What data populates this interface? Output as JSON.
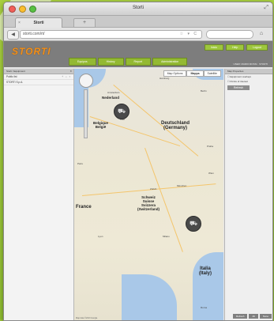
{
  "window": {
    "title": "Storti"
  },
  "tab": {
    "label": "Storti",
    "close": "×",
    "new_tab": "+"
  },
  "address": {
    "url": "storti.com/rt/",
    "icons": "☆ ▾ C"
  },
  "app": {
    "logo": "STORTI",
    "top_buttons": [
      "Inicio",
      "Help",
      "Logout"
    ],
    "nav_tabs": [
      "Equipos",
      "History",
      "Report",
      "Administration"
    ],
    "user_line": "USER: MARIO ROSSI · STORTI"
  },
  "left_panel": {
    "header": "Storti / Equipment",
    "rows": [
      {
        "label": "Public list",
        "icons": "+ ⌕ ▾"
      },
      {
        "label": "STORTI S.p.A.",
        "icons": ""
      }
    ]
  },
  "map": {
    "map_types": [
      "Map Options",
      "Mappa",
      "Satellite"
    ],
    "markers": [
      {
        "name": "truck-marker-1",
        "glyph": "⛟"
      },
      {
        "name": "truck-marker-2",
        "glyph": "⛟"
      }
    ],
    "labels": {
      "netherlands": "Nederland",
      "belgium": "Belgique\nBelgië",
      "germany": "Deutschland\n(Germany)",
      "france": "France",
      "switzerland": "Schweiz\nSuisse\nSvizzera\n(Switzerland)",
      "italy": "Italia\n(Italy)"
    },
    "cities": [
      "Amsterdam",
      "Hamburg",
      "Berlin",
      "Köln",
      "Paris",
      "München",
      "Wien",
      "Milano",
      "Roma",
      "Zürich",
      "Praha",
      "Lyon"
    ],
    "copyright": "Map data ©2013 Google"
  },
  "right_panel": {
    "header": "Map Properties",
    "checkboxes": [
      "Equipment overlays",
      "Points of interest"
    ],
    "button": "Refresh",
    "bottom_buttons": [
      "Refresh",
      "All",
      "None"
    ]
  },
  "colors": {
    "accent_green": "#9ec63d",
    "logo_orange": "#f0901e",
    "header_gray": "#7d7d7d"
  }
}
